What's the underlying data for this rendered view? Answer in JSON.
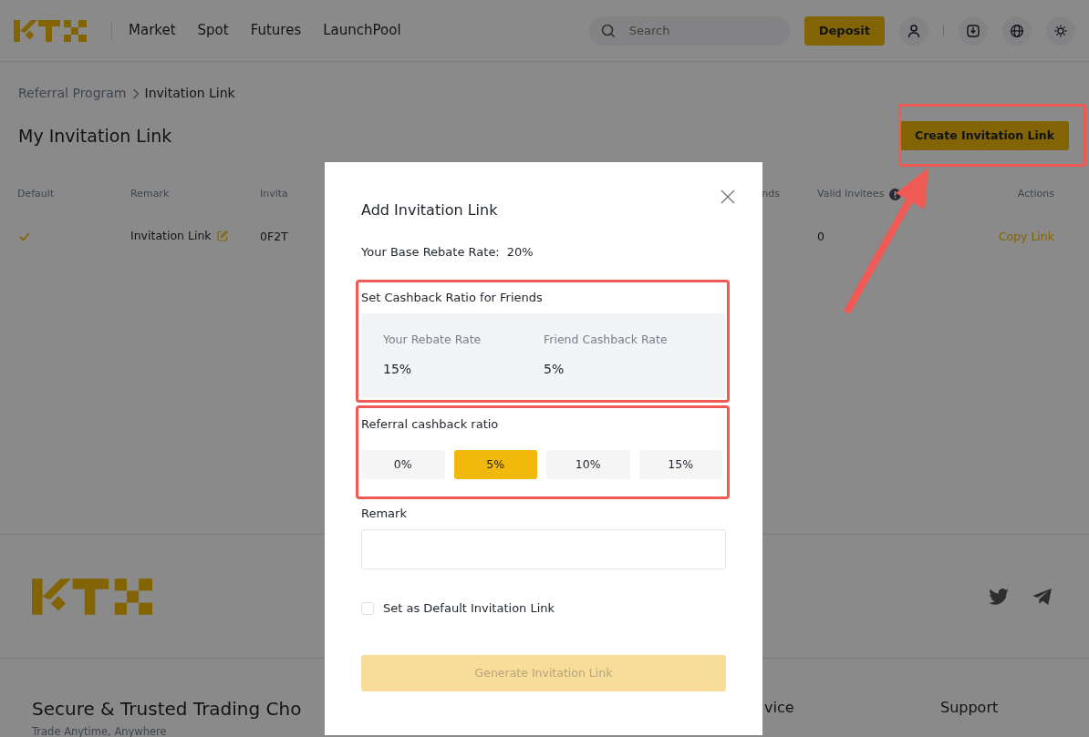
{
  "header": {
    "nav": [
      "Market",
      "Spot",
      "Futures",
      "LaunchPool"
    ],
    "search": {
      "placeholder": "Search"
    },
    "deposit": "Deposit"
  },
  "breadcrumb": [
    {
      "label": "Referral Program",
      "current": false
    },
    {
      "label": "Invitation Link",
      "current": true
    }
  ],
  "page_title": "My Invitation Link",
  "create_button": "Create Invitation Link",
  "table": {
    "columns": [
      {
        "label": "Default",
        "info": false
      },
      {
        "label": "Remark",
        "info": false
      },
      {
        "label": "Invita",
        "info": false
      },
      {
        "label": "nds",
        "info": false
      },
      {
        "label": "Valid Invitees",
        "info": true
      },
      {
        "label": "Actions",
        "info": false
      }
    ],
    "rows": [
      {
        "default": true,
        "remark": "Invitation Link",
        "code": "0F2T",
        "valid_invitees": "0",
        "action": "Copy Link"
      }
    ]
  },
  "modal": {
    "title": "Add Invitation Link",
    "base_rate_label": "Your Base Rebate Rate:",
    "base_rate": "20%",
    "cashback_heading": "Set Cashback Ratio for Friends",
    "rates": [
      {
        "label": "Your Rebate Rate",
        "value": "15%"
      },
      {
        "label": "Friend Cashback Rate",
        "value": "5%"
      }
    ],
    "ratio_label": "Referral cashback ratio",
    "ratio_options": [
      {
        "label": "0%",
        "selected": false
      },
      {
        "label": "5%",
        "selected": true
      },
      {
        "label": "10%",
        "selected": false
      },
      {
        "label": "15%",
        "selected": false
      }
    ],
    "remark_label": "Remark",
    "default_checkbox": {
      "label": "Set as Default Invitation Link",
      "checked": false
    },
    "generate_button": {
      "label": "Generate Invitation Link",
      "disabled": true
    }
  },
  "footer": {
    "headline": "Secure & Trusted Trading Cho",
    "tagline": "Trade Anytime, Anywhere",
    "columns": [
      "vice",
      "Support"
    ]
  }
}
